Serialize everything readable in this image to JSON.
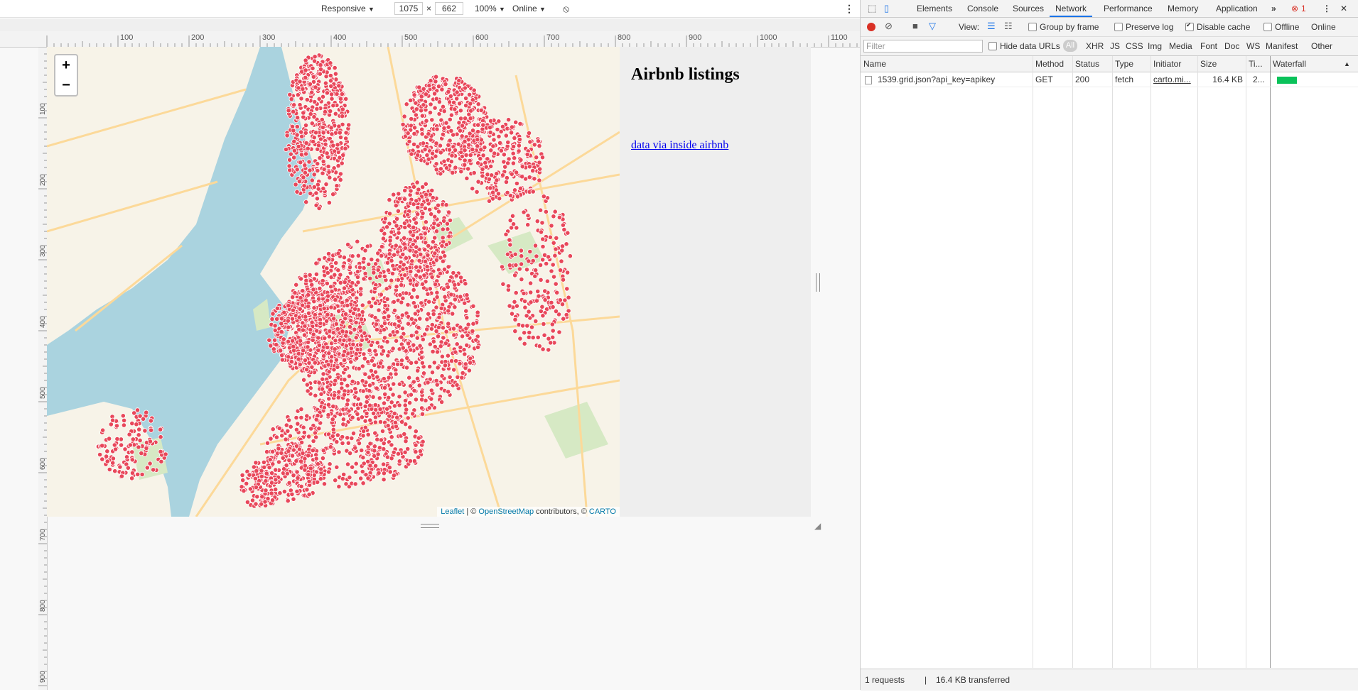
{
  "device_toolbar": {
    "device": "Responsive",
    "width": "1075",
    "times": "×",
    "height": "662",
    "zoom": "100%",
    "network": "Online"
  },
  "rulers": {
    "h_ticks": [
      "100",
      "200",
      "300",
      "400",
      "500",
      "600",
      "700",
      "800",
      "900",
      "1000",
      "1100"
    ],
    "v_ticks": [
      "100",
      "200",
      "300",
      "400",
      "500",
      "600",
      "700",
      "800",
      "900"
    ]
  },
  "page": {
    "title": "Airbnb listings",
    "link": "data via inside airbnb",
    "zoom_in": "+",
    "zoom_out": "−",
    "attribution": {
      "leaflet": "Leaflet",
      "sep1": " | © ",
      "osm": "OpenStreetMap",
      "mid": " contributors, © ",
      "carto": "CARTO"
    }
  },
  "devtools": {
    "tabs": [
      "Elements",
      "Console",
      "Sources",
      "Network",
      "Performance",
      "Memory",
      "Application"
    ],
    "active_tab": "Network",
    "more": "»",
    "error_count": "1",
    "toolbar": {
      "view_label": "View:",
      "group_by_frame": "Group by frame",
      "preserve_log": "Preserve log",
      "disable_cache": "Disable cache",
      "offline": "Offline",
      "online": "Online"
    },
    "filter_placeholder": "Filter",
    "hide_data_urls": "Hide data URLs",
    "filter_types": [
      "All",
      "XHR",
      "JS",
      "CSS",
      "Img",
      "Media",
      "Font",
      "Doc",
      "WS",
      "Manifest",
      "Other"
    ],
    "columns": [
      "Name",
      "Method",
      "Status",
      "Type",
      "Initiator",
      "Size",
      "Ti...",
      "Waterfall"
    ],
    "requests": [
      {
        "name": "1539.grid.json?api_key=apikey",
        "method": "GET",
        "status": "200",
        "type": "fetch",
        "initiator": "carto.mi...",
        "size": "16.4 KB",
        "time": "2..."
      }
    ],
    "status_bar": {
      "requests": "1 requests",
      "sep": "|",
      "transferred": "16.4 KB transferred"
    }
  },
  "colors": {
    "marker": "#e8475a",
    "water": "#aad3df",
    "land": "#f7f3e8",
    "waterfall_bar": "#0ac25a",
    "tab_accent": "#1a73e8"
  }
}
